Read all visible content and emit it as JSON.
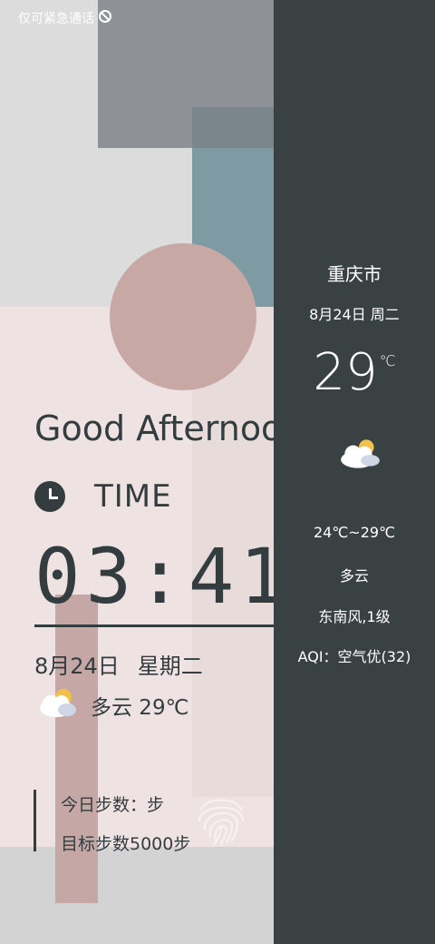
{
  "status_bar": {
    "left_text": "仅可紧急通话",
    "icons": [
      "no-signal-icon",
      "bluetooth-icon",
      "signal-icon",
      "charging-battery-icon"
    ],
    "battery_color": "#5fd16a"
  },
  "widget": {
    "greeting": "Good Afternoon",
    "time_label": "TIME",
    "clock": "03:41",
    "date": "8月24日",
    "weekday": "星期二",
    "weather": "多云 29℃",
    "steps_today": "今日步数：步",
    "steps_goal": "目标步数5000步",
    "text_color": "#333c3f"
  },
  "side_panel": {
    "city": "重庆市",
    "date": "8月24日 周二",
    "temp": "29",
    "temp_unit": "℃",
    "range": "24℃~29℃",
    "condition": "多云",
    "wind": "东南风,1级",
    "aqi": "AQI：空气优(32)",
    "background": "#3a4143"
  }
}
